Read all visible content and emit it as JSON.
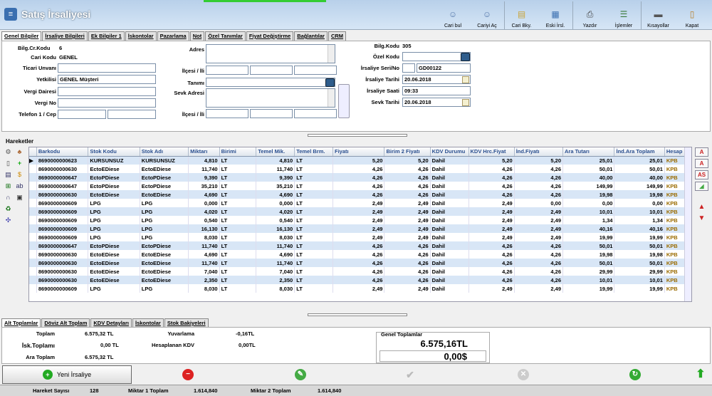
{
  "window": {
    "title": "Satış İrsaliyesi"
  },
  "toolbar": [
    {
      "name": "cari-bul",
      "label": "Cari bul",
      "icon": "person-search-icon"
    },
    {
      "name": "cariyi-ac",
      "label": "Cariyi Aç",
      "icon": "person-open-icon"
    },
    {
      "name": "cari-bky",
      "label": "Cari Bky.",
      "icon": "document-person-icon"
    },
    {
      "name": "eski-irsl",
      "label": "Eski İrsl.",
      "icon": "archive-icon"
    },
    {
      "name": "yazdir",
      "label": "Yazdır",
      "icon": "printer-icon"
    },
    {
      "name": "islemler",
      "label": "İşlemler",
      "icon": "list-icon"
    },
    {
      "name": "kisayollar",
      "label": "Kısayollar",
      "icon": "keyboard-icon"
    },
    {
      "name": "kapat",
      "label": "Kapat",
      "icon": "door-exit-icon"
    }
  ],
  "tabs": [
    "Genel Bilgiler",
    "İrsaliye Bilgileri",
    "Ek Bilgiler 1",
    "İskontolar",
    "Pazarlama",
    "Not",
    "Özel Tanımlar",
    "Fiyat Değiştirme",
    "Bağlantılar",
    "CRM"
  ],
  "form": {
    "bilg_cr_kodu_label": "Bilg.Cr.Kodu",
    "bilg_cr_kodu": "6",
    "cari_kodu_label": "Cari Kodu",
    "cari_kodu": "GENEL",
    "ticari_unvani_label": "Ticari Unvanı",
    "ticari_unvani": "",
    "yetkilisi_label": "Yetkilisi",
    "yetkilisi": "GENEL Müşteri",
    "vergi_dairesi_label": "Vergi Dairesi",
    "vergi_no_label": "Vergi No",
    "telefon_label": "Telefon 1 / Cep",
    "adres_label": "Adres",
    "ilcesi_label": "İlçesi / İli",
    "tanimi_label": "Tanımı",
    "sevk_adresi_label": "Sevk Adresi",
    "ilcesi2_label": "İlçesi / İli",
    "bilg_kodu_label": "Bilg.Kodu",
    "bilg_kodu": "305",
    "ozel_kodu_label": "Özel Kodu",
    "seri_no_label": "İrsaliye Seri/No",
    "seri_no": "GD00122",
    "irsaliye_tarihi_label": "İrsaliye Tarihi",
    "irsaliye_tarihi": "20.06.2018",
    "irsaliye_saati_label": "İrsaliye Saati",
    "irsaliye_saati": "09:33",
    "sevk_tarihi_label": "Sevk Tarihi",
    "sevk_tarihi": "20.06.2018"
  },
  "hareketler_label": "Hareketler",
  "columns": [
    "Barkodu",
    "Stok Kodu",
    "Stok Adı",
    "Miktarı",
    "Birimi",
    "Temel Mik.",
    "Temel Brm.",
    "Fiyatı",
    "Birim 2 Fiyatı",
    "KDV Durumu",
    "KDV Hrc.Fiyat",
    "İnd.Fiyatı",
    "Ara Tutarı",
    "İnd.Ara Toplam",
    "Hesap"
  ],
  "rows": [
    [
      "8690000000623",
      "KURSUNSUZ",
      "KURSUNSUZ",
      "4,810",
      "LT",
      "4,810",
      "LT",
      "5,20",
      "5,20",
      "Dahil",
      "5,20",
      "5,20",
      "25,01",
      "25,01",
      "KPB"
    ],
    [
      "8690000000630",
      "EctoEDiese",
      "EctoEDiese",
      "11,740",
      "LT",
      "11,740",
      "LT",
      "4,26",
      "4,26",
      "Dahil",
      "4,26",
      "4,26",
      "50,01",
      "50,01",
      "KPB"
    ],
    [
      "8690000000647",
      "EctoPDiese",
      "EctoPDiese",
      "9,390",
      "LT",
      "9,390",
      "LT",
      "4,26",
      "4,26",
      "Dahil",
      "4,26",
      "4,26",
      "40,00",
      "40,00",
      "KPB"
    ],
    [
      "8690000000647",
      "EctoPDiese",
      "EctoPDiese",
      "35,210",
      "LT",
      "35,210",
      "LT",
      "4,26",
      "4,26",
      "Dahil",
      "4,26",
      "4,26",
      "149,99",
      "149,99",
      "KPB"
    ],
    [
      "8690000000630",
      "EctoEDiese",
      "EctoEDiese",
      "4,690",
      "LT",
      "4,690",
      "LT",
      "4,26",
      "4,26",
      "Dahil",
      "4,26",
      "4,26",
      "19,98",
      "19,98",
      "KPB"
    ],
    [
      "8690000000609",
      "LPG",
      "LPG",
      "0,000",
      "LT",
      "0,000",
      "LT",
      "2,49",
      "2,49",
      "Dahil",
      "2,49",
      "0,00",
      "0,00",
      "0,00",
      "KPB"
    ],
    [
      "8690000000609",
      "LPG",
      "LPG",
      "4,020",
      "LT",
      "4,020",
      "LT",
      "2,49",
      "2,49",
      "Dahil",
      "2,49",
      "2,49",
      "10,01",
      "10,01",
      "KPB"
    ],
    [
      "8690000000609",
      "LPG",
      "LPG",
      "0,540",
      "LT",
      "0,540",
      "LT",
      "2,49",
      "2,49",
      "Dahil",
      "2,49",
      "2,49",
      "1,34",
      "1,34",
      "KPB"
    ],
    [
      "8690000000609",
      "LPG",
      "LPG",
      "16,130",
      "LT",
      "16,130",
      "LT",
      "2,49",
      "2,49",
      "Dahil",
      "2,49",
      "2,49",
      "40,16",
      "40,16",
      "KPB"
    ],
    [
      "8690000000609",
      "LPG",
      "LPG",
      "8,030",
      "LT",
      "8,030",
      "LT",
      "2,49",
      "2,49",
      "Dahil",
      "2,49",
      "2,49",
      "19,99",
      "19,99",
      "KPB"
    ],
    [
      "8690000000647",
      "EctoPDiese",
      "EctoPDiese",
      "11,740",
      "LT",
      "11,740",
      "LT",
      "4,26",
      "4,26",
      "Dahil",
      "4,26",
      "4,26",
      "50,01",
      "50,01",
      "KPB"
    ],
    [
      "8690000000630",
      "EctoEDiese",
      "EctoEDiese",
      "4,690",
      "LT",
      "4,690",
      "LT",
      "4,26",
      "4,26",
      "Dahil",
      "4,26",
      "4,26",
      "19,98",
      "19,98",
      "KPB"
    ],
    [
      "8690000000630",
      "EctoEDiese",
      "EctoEDiese",
      "11,740",
      "LT",
      "11,740",
      "LT",
      "4,26",
      "4,26",
      "Dahil",
      "4,26",
      "4,26",
      "50,01",
      "50,01",
      "KPB"
    ],
    [
      "8690000000630",
      "EctoEDiese",
      "EctoEDiese",
      "7,040",
      "LT",
      "7,040",
      "LT",
      "4,26",
      "4,26",
      "Dahil",
      "4,26",
      "4,26",
      "29,99",
      "29,99",
      "KPB"
    ],
    [
      "8690000000630",
      "EctoEDiese",
      "EctoEDiese",
      "2,350",
      "LT",
      "2,350",
      "LT",
      "4,26",
      "4,26",
      "Dahil",
      "4,26",
      "4,26",
      "10,01",
      "10,01",
      "KPB"
    ],
    [
      "8690000000609",
      "LPG",
      "LPG",
      "8,030",
      "LT",
      "8,030",
      "LT",
      "2,49",
      "2,49",
      "Dahil",
      "2,49",
      "2,49",
      "19,99",
      "19,99",
      "KPB"
    ]
  ],
  "right_tools": [
    "A",
    "A",
    "AS"
  ],
  "bottom_tabs": [
    "Alt Toplamlar",
    "Döviz Alt Toplam",
    "KDV Detayları",
    "İskontolar",
    "Stok Bakiyeleri"
  ],
  "totals": {
    "toplam_label": "Toplam",
    "toplam": "6.575,32 TL",
    "isk_label": "İsk.Toplamı",
    "isk": "0,00 TL",
    "ara_label": "Ara Toplam",
    "ara": "6.575,32 TL",
    "yuvarlama_label": "Yuvarlama",
    "yuvarlama": "-0,16TL",
    "hesaplanan_label": "Hesaplanan KDV",
    "hesaplanan": "0,00TL",
    "genel_label": "Genel Toplamlar",
    "genel_tl": "6.575,16TL",
    "genel_usd": "0,00$"
  },
  "actions": {
    "new": "Yeni İrsaliye"
  },
  "status": {
    "hareket_label": "Hareket Sayısı",
    "hareket": "128",
    "miktar1_label": "Miktar 1 Toplam",
    "miktar1": "1.614,840",
    "miktar2_label": "Miktar 2 Toplam",
    "miktar2": "1.614,840"
  }
}
